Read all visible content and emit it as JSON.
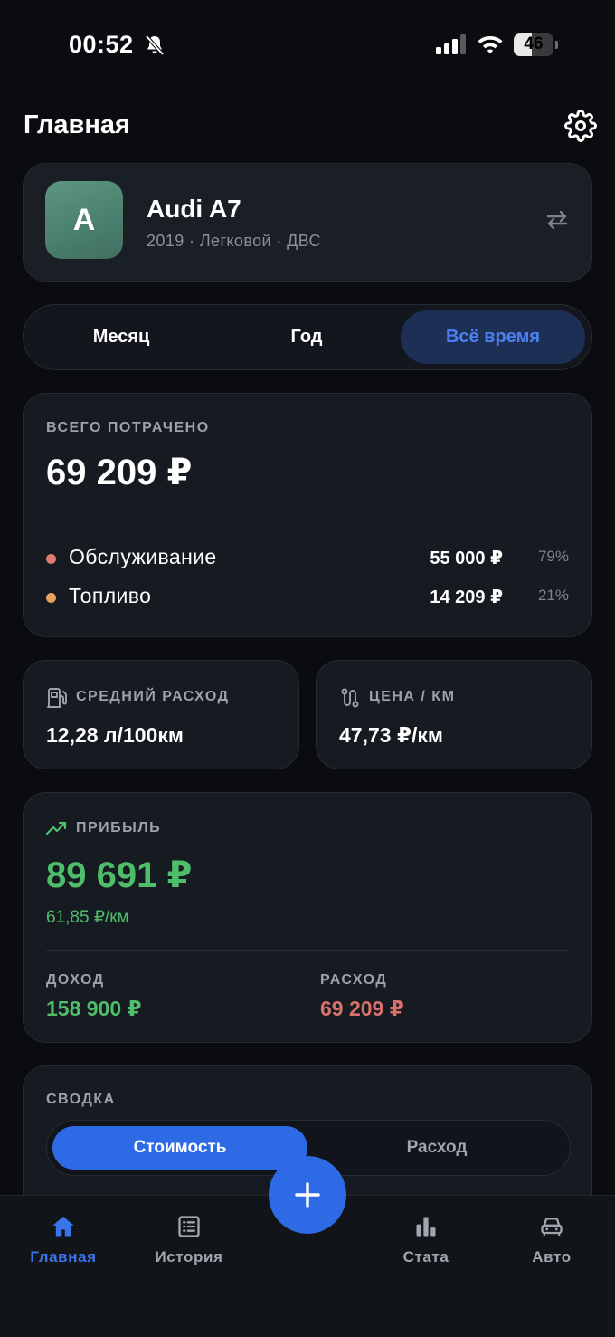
{
  "status_bar": {
    "time": "00:52",
    "battery": "46",
    "battery_level": 0.46
  },
  "header": {
    "title": "Главная"
  },
  "vehicle": {
    "initial": "A",
    "name": "Audi A7",
    "meta": "2019 · Легковой · ДВС"
  },
  "period_tabs": [
    {
      "label": "Месяц",
      "active": false
    },
    {
      "label": "Год",
      "active": false
    },
    {
      "label": "Всё время",
      "active": true
    }
  ],
  "total": {
    "label": "ВСЕГО ПОТРАЧЕНО",
    "value": "69 209 ₽",
    "breakdown": [
      {
        "label": "Обслуживание",
        "amount": "55 000 ₽",
        "percent": "79%",
        "color": "#e07a72"
      },
      {
        "label": "Топливо",
        "amount": "14 209 ₽",
        "percent": "21%",
        "color": "#e8a15e"
      }
    ]
  },
  "metrics": {
    "avg_consumption": {
      "label": "СРЕДНИЙ РАСХОД",
      "value": "12,28 л/100км",
      "icon": "fuel-pump-icon"
    },
    "price_per_km": {
      "label": "ЦЕНА / КМ",
      "value": "47,73 ₽/км",
      "icon": "route-icon"
    }
  },
  "profit": {
    "label": "ПРИБЫЛЬ",
    "value": "89 691 ₽",
    "per_km": "61,85 ₽/км",
    "income_label": "ДОХОД",
    "income_value": "158 900 ₽",
    "expense_label": "РАСХОД",
    "expense_value": "69 209 ₽"
  },
  "summary": {
    "label": "СВОДКА",
    "tabs": [
      {
        "label": "Стоимость",
        "active": true
      },
      {
        "label": "Расход",
        "active": false
      }
    ]
  },
  "tab_bar": {
    "items": [
      {
        "label": "Главная",
        "icon": "home-icon",
        "active": true
      },
      {
        "label": "История",
        "icon": "list-icon",
        "active": false
      },
      {
        "label": "Стата",
        "icon": "bar-chart-icon",
        "active": false
      },
      {
        "label": "Авто",
        "icon": "car-icon",
        "active": false
      }
    ],
    "fab_icon": "plus-icon"
  },
  "colors": {
    "accent": "#2f6ae6",
    "positive": "#4fbe6a",
    "negative": "#d8716c",
    "background": "#0b0c0f",
    "card": "#161a21"
  }
}
